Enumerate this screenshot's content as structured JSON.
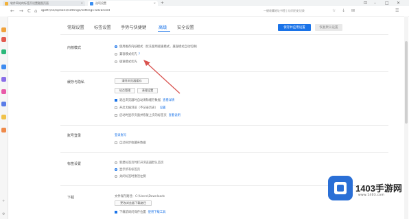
{
  "browser": {
    "tabs": [
      {
        "label": "软件网站的标签页设置截图页面",
        "favicon_color": "#f2b23a"
      },
      {
        "label": "选项设置",
        "favicon_color": "#3b8ef0"
      }
    ],
    "new_tab_label": "+",
    "window_controls": {
      "pin": "⊡",
      "minimize": "–",
      "maximize": "□",
      "close": "✕"
    },
    "address": {
      "back": "←",
      "forward": "→",
      "reload": "C",
      "home": "⌂",
      "url": "qpdf://se/options/settings/settings-advanced",
      "right_text": "一键收藏地址书签 | 访问历史记录"
    },
    "toolbar_icons": [
      "☆",
      "↓",
      "⊞",
      "☰"
    ]
  },
  "settings": {
    "tabs": [
      {
        "label": "常规设置"
      },
      {
        "label": "标签设置"
      },
      {
        "label": "手势与快捷键"
      },
      {
        "label": "高级"
      },
      {
        "label": "安全设置"
      }
    ],
    "save_label": "保存并应用设置",
    "cancel_label": "恢复默认设置",
    "sections": [
      {
        "label": "内核模式",
        "options": [
          {
            "text": "使用推荐内核模式（优先使用极速模式，兼容模式自动切换）",
            "type": "radio",
            "checked": true
          },
          {
            "text": "兼容模式优先",
            "type": "radio",
            "checked": false,
            "hint": "?"
          },
          {
            "text": "极速模式优先",
            "type": "radio",
            "checked": false
          }
        ]
      },
      {
        "label": "缓存与隐私",
        "buttons": [
          "清除浏览器缓存",
          "站点管理",
          "清理设置"
        ],
        "options": [
          {
            "text": "退出浏览器时自动清除缓存数据",
            "type": "check",
            "checked": true,
            "link": "查看详情"
          },
          {
            "text": "开启无痕浏览（不记录历史）",
            "type": "check",
            "checked": false,
            "link": "设置"
          },
          {
            "text": "启动时显示页面并恢复上次的标签页",
            "type": "check",
            "checked": false,
            "link": "查看说明"
          }
        ]
      },
      {
        "label": "账号登录",
        "link": "登录账号",
        "options": [
          {
            "text": "自动同步收藏夹数据",
            "type": "check",
            "checked": false
          }
        ]
      },
      {
        "label": "标签设置",
        "options": [
          {
            "text": "新建标签页时打开浏览器默认首页",
            "type": "radio",
            "checked": false
          },
          {
            "text": "显示所有标签页",
            "type": "radio",
            "checked": true
          },
          {
            "text": "关闭标签时激活左侧",
            "type": "radio",
            "checked": false
          }
        ]
      },
      {
        "label": "下载",
        "lead": "文件保存路径：C:\\Users\\Downloads",
        "buttons": [
          "更改浏览器下载路径"
        ],
        "options": [
          {
            "text": "下载前询问保存位置",
            "type": "check",
            "checked": true,
            "link": "使用下载工具"
          }
        ]
      }
    ]
  },
  "watermark": {
    "title": "1403手游网",
    "url": "www.1403.com"
  },
  "colors": {
    "accent": "#1a73e8",
    "arrow": "#d9534f",
    "watermark_blue": "#2a6fd6"
  }
}
